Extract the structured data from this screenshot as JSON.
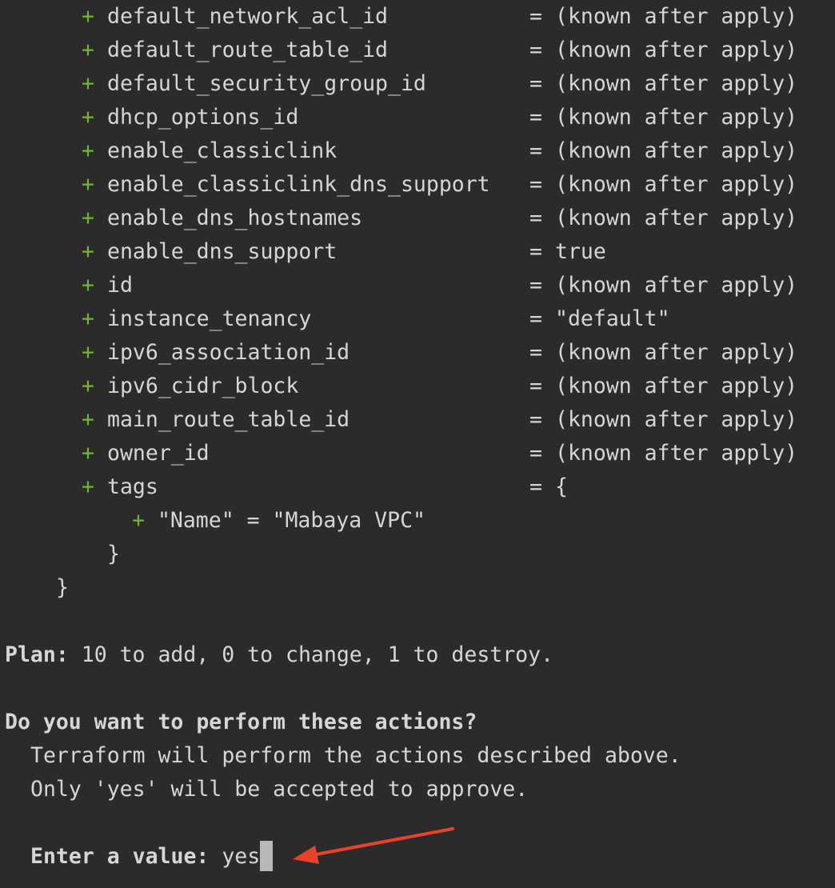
{
  "attributes": [
    {
      "plus": "+",
      "name": "default_network_acl_id",
      "eq": "=",
      "value": "(known after apply)"
    },
    {
      "plus": "+",
      "name": "default_route_table_id",
      "eq": "=",
      "value": "(known after apply)"
    },
    {
      "plus": "+",
      "name": "default_security_group_id",
      "eq": "=",
      "value": "(known after apply)"
    },
    {
      "plus": "+",
      "name": "dhcp_options_id",
      "eq": "=",
      "value": "(known after apply)"
    },
    {
      "plus": "+",
      "name": "enable_classiclink",
      "eq": "=",
      "value": "(known after apply)"
    },
    {
      "plus": "+",
      "name": "enable_classiclink_dns_support",
      "eq": "=",
      "value": "(known after apply)"
    },
    {
      "plus": "+",
      "name": "enable_dns_hostnames",
      "eq": "=",
      "value": "(known after apply)"
    },
    {
      "plus": "+",
      "name": "enable_dns_support",
      "eq": "=",
      "value": "true"
    },
    {
      "plus": "+",
      "name": "id",
      "eq": "=",
      "value": "(known after apply)"
    },
    {
      "plus": "+",
      "name": "instance_tenancy",
      "eq": "=",
      "value": "\"default\""
    },
    {
      "plus": "+",
      "name": "ipv6_association_id",
      "eq": "=",
      "value": "(known after apply)"
    },
    {
      "plus": "+",
      "name": "ipv6_cidr_block",
      "eq": "=",
      "value": "(known after apply)"
    },
    {
      "plus": "+",
      "name": "main_route_table_id",
      "eq": "=",
      "value": "(known after apply)"
    },
    {
      "plus": "+",
      "name": "owner_id",
      "eq": "=",
      "value": "(known after apply)"
    },
    {
      "plus": "+",
      "name": "tags",
      "eq": "=",
      "value": "{"
    }
  ],
  "tag_entry": {
    "plus": "+",
    "text": "\"Name\" = \"Mabaya VPC\""
  },
  "tags_close": "}",
  "resource_close": "}",
  "plan": {
    "label": "Plan:",
    "text": " 10 to add, 0 to change, 1 to destroy."
  },
  "prompt": {
    "question": "Do you want to perform these actions?",
    "line1": "Terraform will perform the actions described above.",
    "line2": "Only 'yes' will be accepted to approve.",
    "label": "Enter a value:",
    "value": " yes"
  },
  "colors": {
    "background": "#2b2b2b",
    "text": "#d6d6d6",
    "plus": "#6fb82e",
    "arrow": "#e8412c"
  },
  "annotation": {
    "icon": "red-arrow-icon"
  }
}
